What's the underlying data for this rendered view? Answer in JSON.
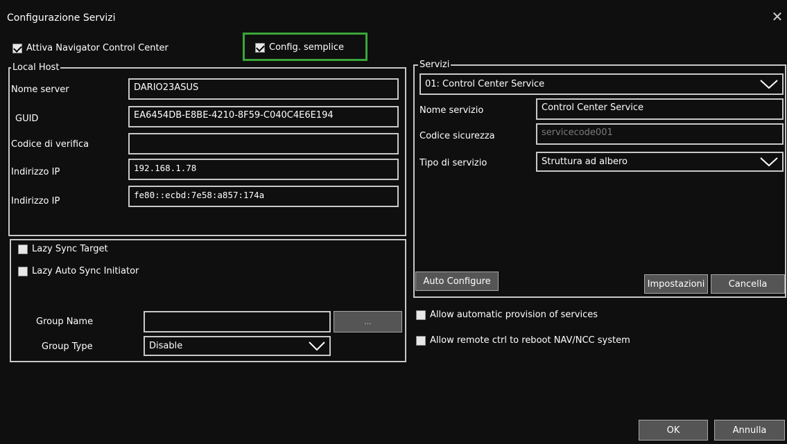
{
  "window": {
    "title": "Configurazione Servizi",
    "close_glyph": "✕"
  },
  "top": {
    "attiva_label": "Attiva Navigator Control Center",
    "attiva_checked": true,
    "config_label": "Config. semplice",
    "config_checked": true
  },
  "local_host": {
    "legend": "Local Host",
    "rows": [
      {
        "label": "Nome server",
        "value": "DARIO23ASUS"
      },
      {
        "label": "GUID",
        "value": "EA6454DB-E8BE-4210-8F59-C040C4E6E194"
      },
      {
        "label": "Codice di verifica",
        "value": ""
      },
      {
        "label": "Indirizzo IP",
        "value": "192.168.1.78"
      },
      {
        "label": "Indirizzo IP",
        "value": "fe80::ecbd:7e58:a857:174a"
      }
    ]
  },
  "sync": {
    "lazy_sync_target": "Lazy Sync Target",
    "lazy_auto_sync": "Lazy Auto Sync Initiator",
    "group_name_label": "Group Name",
    "group_name_value": "",
    "browse_label": "...",
    "group_type_label": "Group Type",
    "group_type_value": "Disable"
  },
  "servizi": {
    "legend": "Servizi",
    "selected_service": "01: Control Center Service",
    "nome_servizio_label": "Nome servizio",
    "nome_servizio_value": "Control Center Service",
    "codice_label": "Codice sicurezza",
    "codice_value": "servicecode001",
    "tipo_label": "Tipo di servizio",
    "tipo_value": "Struttura ad albero",
    "auto_configure": "Auto Configure",
    "impostazioni": "Impostazioni",
    "cancella": "Cancella"
  },
  "options": {
    "allow_provision": "Allow automatic provision of services",
    "allow_reboot": "Allow remote ctrl to reboot NAV/NCC system"
  },
  "footer": {
    "ok": "OK",
    "annulla": "Annulla"
  },
  "colors": {
    "background": "#0f0f0f",
    "highlight": "#3aa63a",
    "button": "#555555"
  },
  "icons": {
    "dropdown": "chevron-down-icon",
    "close": "close-icon",
    "checkbox": "checkbox-icon"
  }
}
